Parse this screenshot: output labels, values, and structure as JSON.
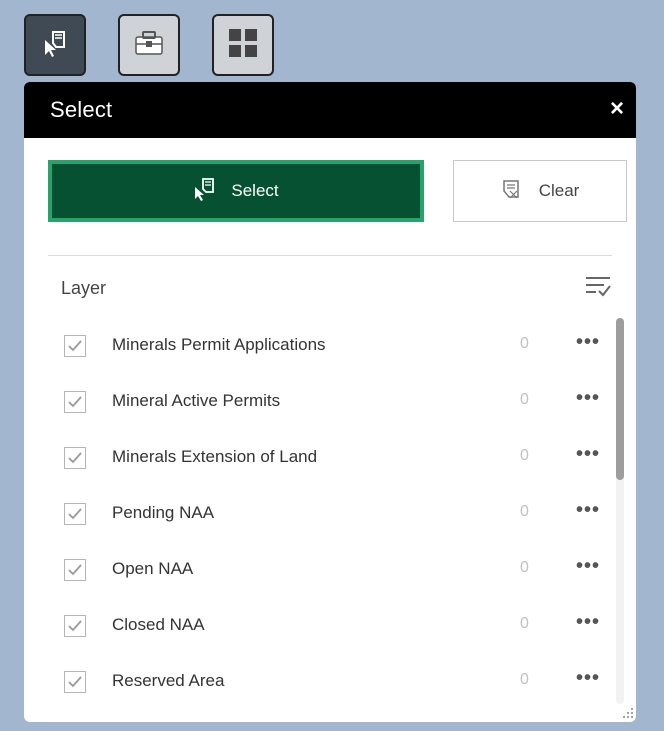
{
  "toolbar": {
    "tools": [
      {
        "icon": "select-cursor-icon",
        "active": true
      },
      {
        "icon": "toolbox-icon",
        "active": false
      },
      {
        "icon": "grid-icon",
        "active": false
      }
    ]
  },
  "panel": {
    "title": "Select",
    "close_label": "×",
    "select_button_label": "Select",
    "clear_button_label": "Clear",
    "layer_header": "Layer"
  },
  "layers": [
    {
      "name": "Minerals Permit Applications",
      "count": "0",
      "checked": true
    },
    {
      "name": "Mineral Active Permits",
      "count": "0",
      "checked": true
    },
    {
      "name": "Minerals Extension of Land",
      "count": "0",
      "checked": true
    },
    {
      "name": "Pending NAA",
      "count": "0",
      "checked": true
    },
    {
      "name": "Open NAA",
      "count": "0",
      "checked": true
    },
    {
      "name": "Closed NAA",
      "count": "0",
      "checked": true
    },
    {
      "name": "Reserved Area",
      "count": "0",
      "checked": true
    }
  ],
  "more_label": "•••",
  "colors": {
    "select_bg": "#065131",
    "select_border": "#27a46b",
    "header_bg": "#000000",
    "map_bg": "#a2b6cf"
  }
}
